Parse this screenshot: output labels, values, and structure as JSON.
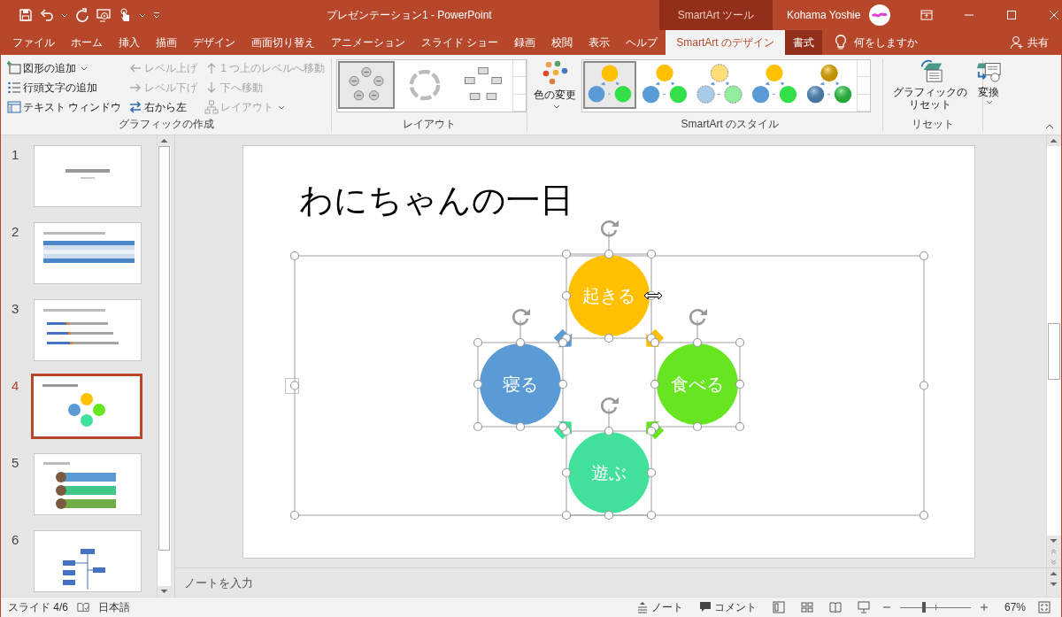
{
  "window": {
    "title": "プレゼンテーション1  -  PowerPoint",
    "context_header": "SmartArt ツール",
    "user": "Kohama Yoshie"
  },
  "tabs": [
    {
      "label": "ファイル",
      "selected": false,
      "kind": "normal"
    },
    {
      "label": "ホーム",
      "selected": false,
      "kind": "normal"
    },
    {
      "label": "挿入",
      "selected": false,
      "kind": "normal"
    },
    {
      "label": "描画",
      "selected": false,
      "kind": "normal"
    },
    {
      "label": "デザイン",
      "selected": false,
      "kind": "normal"
    },
    {
      "label": "画面切り替え",
      "selected": false,
      "kind": "normal"
    },
    {
      "label": "アニメーション",
      "selected": false,
      "kind": "normal"
    },
    {
      "label": "スライド ショー",
      "selected": false,
      "kind": "normal"
    },
    {
      "label": "録画",
      "selected": false,
      "kind": "normal"
    },
    {
      "label": "校閲",
      "selected": false,
      "kind": "normal"
    },
    {
      "label": "表示",
      "selected": false,
      "kind": "normal"
    },
    {
      "label": "ヘルプ",
      "selected": false,
      "kind": "normal"
    },
    {
      "label": "SmartArt のデザイン",
      "selected": true,
      "kind": "contextual"
    },
    {
      "label": "書式",
      "selected": false,
      "kind": "contextual"
    }
  ],
  "tell_me": {
    "placeholder": "何をしますか"
  },
  "share": "共有",
  "ribbon": {
    "create_group": {
      "label": "グラフィックの作成",
      "columns": [
        [
          {
            "label": "図形の追加",
            "disabled": false,
            "dropdown": true
          },
          {
            "label": "行頭文字の追加",
            "disabled": false,
            "dropdown": false
          },
          {
            "label": "テキスト ウィンドウ",
            "disabled": false,
            "dropdown": false
          }
        ],
        [
          {
            "label": "レベル上げ",
            "disabled": true,
            "dropdown": false
          },
          {
            "label": "レベル下げ",
            "disabled": true,
            "dropdown": false
          },
          {
            "label": "右から左",
            "disabled": false,
            "dropdown": false
          }
        ],
        [
          {
            "label": "1 つ上のレベルへ移動",
            "disabled": true,
            "dropdown": false
          },
          {
            "label": "下へ移動",
            "disabled": true,
            "dropdown": false
          },
          {
            "label": "レイアウト",
            "disabled": true,
            "dropdown": true
          }
        ]
      ]
    },
    "layout_group": {
      "label": "レイアウト",
      "items": [
        {
          "kind": "basic-cycle",
          "selected": true
        },
        {
          "kind": "arrow-cycle",
          "selected": false
        },
        {
          "kind": "block-cycle",
          "selected": false
        }
      ]
    },
    "color_button": "色の変更",
    "style_group": {
      "label": "SmartArt のスタイル",
      "items": [
        {
          "kind": "flat",
          "selected": true
        },
        {
          "kind": "flat",
          "selected": false
        },
        {
          "kind": "light",
          "selected": false
        },
        {
          "kind": "flat",
          "selected": false
        },
        {
          "kind": "shaded",
          "selected": false
        }
      ]
    },
    "reset_group": {
      "label": "リセット",
      "buttons": [
        {
          "label": "グラフィックのリセット",
          "dropdown": false
        },
        {
          "label": "変換",
          "dropdown": true
        }
      ]
    }
  },
  "slides": [
    {
      "number": "1",
      "kind": "title",
      "selected": false
    },
    {
      "number": "2",
      "kind": "table",
      "selected": false
    },
    {
      "number": "3",
      "kind": "bar",
      "selected": false
    },
    {
      "number": "4",
      "kind": "smartart",
      "selected": true
    },
    {
      "number": "5",
      "kind": "list",
      "selected": false
    },
    {
      "number": "6",
      "kind": "org",
      "selected": false
    }
  ],
  "slide": {
    "title": "わにちゃんの一日",
    "nodes": [
      {
        "label": "起きる",
        "color": "#ffc000"
      },
      {
        "label": "食べる",
        "color": "#67e520"
      },
      {
        "label": "遊ぶ",
        "color": "#41e09b"
      },
      {
        "label": "寝る",
        "color": "#5b9bd5"
      }
    ]
  },
  "notes": {
    "placeholder": "ノートを入力"
  },
  "status_bar": {
    "slide": "スライド 4/6",
    "language": "日本語",
    "notes": "ノート",
    "comments": "コメント",
    "zoom": "67%",
    "zoom_level": {
      "level": 0.31
    }
  }
}
